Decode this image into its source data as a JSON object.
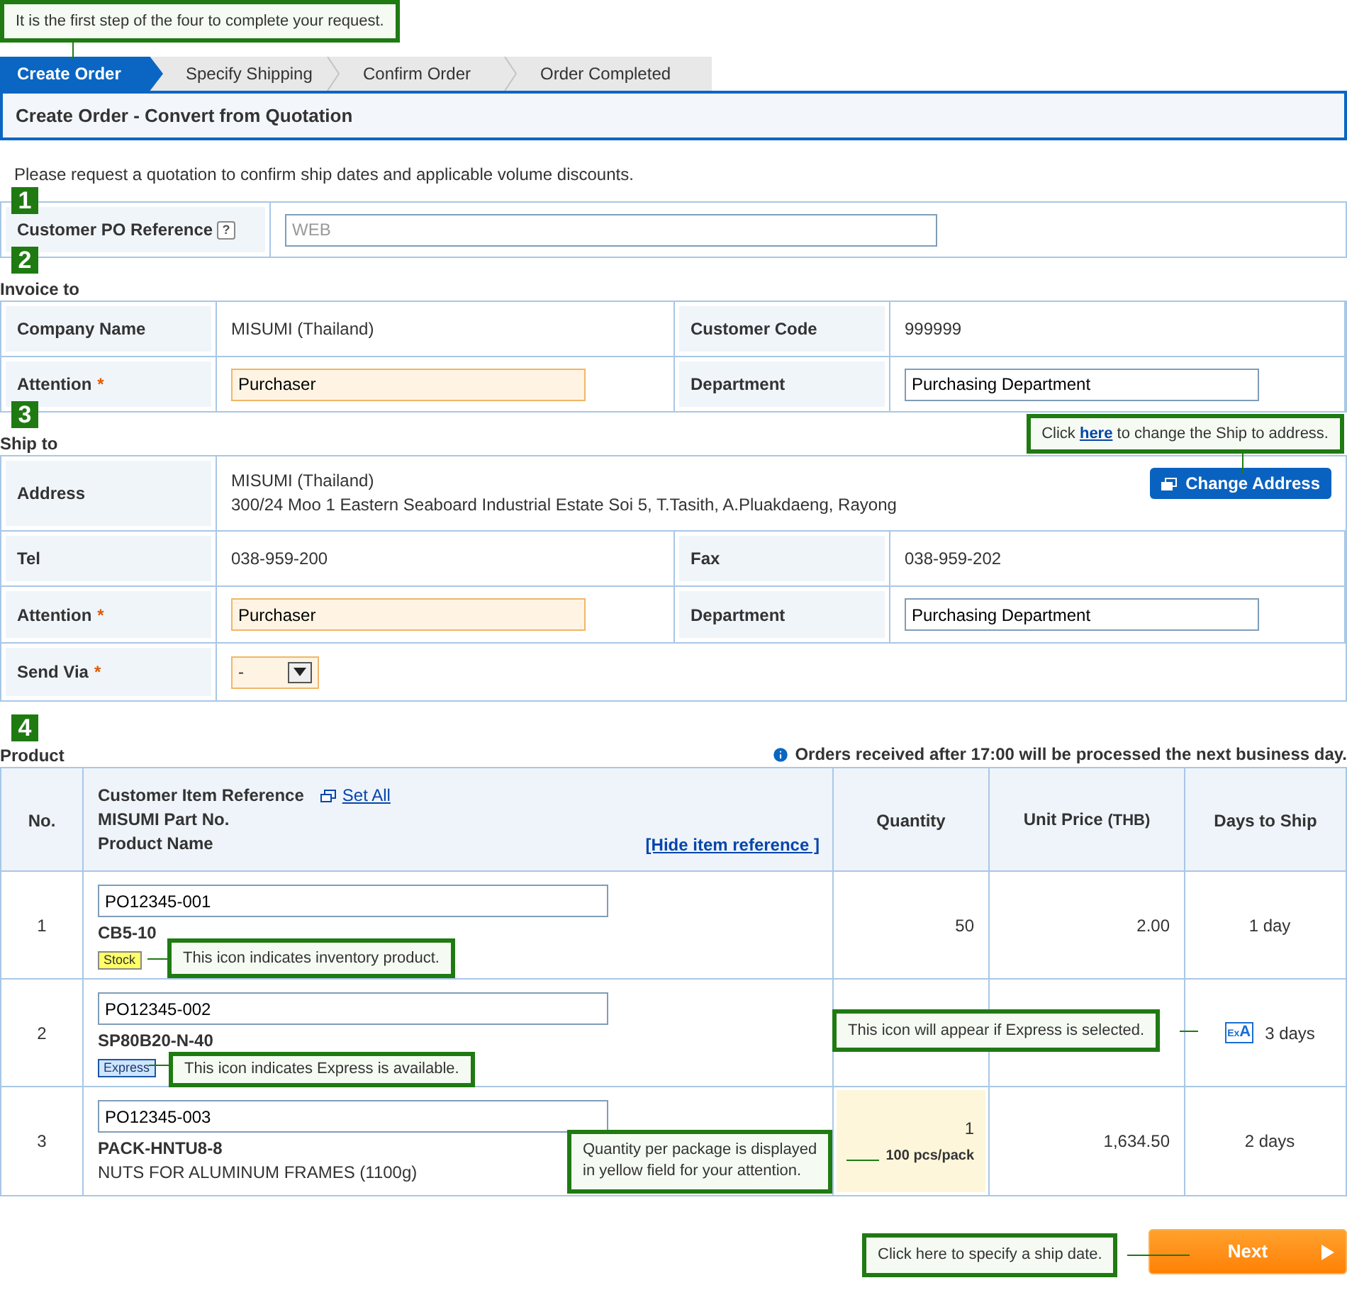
{
  "callouts": [
    {
      "text": "It is the first step of the four to complete your request."
    },
    {
      "before": "Click ",
      "link": "here",
      "after": " to change the Ship to address."
    },
    {
      "text": "This icon indicates inventory product."
    },
    {
      "text": "This icon indicates Express is available."
    },
    {
      "text": "This icon will appear if Express is selected."
    },
    {
      "lines": [
        "Quantity per package is displayed",
        "in yellow field for your attention."
      ]
    },
    {
      "text": "Click here to specify a ship date."
    }
  ],
  "steps": [
    {
      "label": "Create Order",
      "selected": true
    },
    {
      "label": "Specify Shipping",
      "selected": false
    },
    {
      "label": "Confirm Order",
      "selected": false
    },
    {
      "label": "Order Completed",
      "selected": false
    }
  ],
  "page_title": "Create Order - Convert from Quotation",
  "notice": "Please request a quotation to confirm ship dates and applicable volume discounts.",
  "required_mark": "*",
  "po": {
    "number": "1",
    "label": "Customer PO Reference",
    "help": "?",
    "placeholder": "WEB"
  },
  "invoice": {
    "number": "2",
    "title": "Invoice to",
    "rows": [
      [
        {
          "kind": "label",
          "text": "Company Name",
          "required": false
        },
        {
          "kind": "text",
          "text": "MISUMI (Thailand)"
        },
        {
          "kind": "label",
          "text": "Customer Code",
          "required": false
        },
        {
          "kind": "text",
          "text": "999999"
        }
      ],
      [
        {
          "kind": "label",
          "text": "Attention",
          "required": true
        },
        {
          "kind": "input",
          "value": "Purchaser",
          "highlight": true
        },
        {
          "kind": "label",
          "text": "Department",
          "required": false
        },
        {
          "kind": "input",
          "value": "Purchasing Department",
          "highlight": false
        }
      ]
    ]
  },
  "ship": {
    "number": "3",
    "title": "Ship to",
    "rows": [
      [
        {
          "kind": "label",
          "text": "Address",
          "required": false
        },
        {
          "kind": "address",
          "lines": [
            "MISUMI (Thailand)",
            "300/24 Moo 1 Eastern Seaboard Industrial Estate Soi 5, T.Tasith, A.Pluakdaeng, Rayong"
          ],
          "button": "Change Address"
        }
      ],
      [
        {
          "kind": "label",
          "text": "Tel",
          "required": false
        },
        {
          "kind": "text",
          "text": "038-959-200"
        },
        {
          "kind": "label",
          "text": "Fax",
          "required": false
        },
        {
          "kind": "text",
          "text": "038-959-202"
        }
      ],
      [
        {
          "kind": "label",
          "text": "Attention",
          "required": true
        },
        {
          "kind": "input",
          "value": "Purchaser",
          "highlight": true
        },
        {
          "kind": "label",
          "text": "Department",
          "required": false
        },
        {
          "kind": "input",
          "value": "Purchasing Department",
          "highlight": false
        }
      ],
      [
        {
          "kind": "label",
          "text": "Send Via",
          "required": true
        },
        {
          "kind": "select",
          "value": "-"
        }
      ]
    ]
  },
  "product": {
    "number": "4",
    "title": "Product",
    "info": "Orders received after 17:00 will be processed the next business day.",
    "columns": [
      {
        "kind": "no",
        "text": "No."
      },
      {
        "kind": "item",
        "lines": [
          "Customer Item Reference",
          "MISUMI Part No.",
          "Product Name"
        ],
        "set_all": "Set All",
        "hide": "[Hide item reference ]"
      },
      {
        "kind": "plain",
        "text": "Quantity"
      },
      {
        "kind": "price",
        "text": "Unit Price",
        "unit": "(THB)"
      },
      {
        "kind": "plain",
        "text": "Days to Ship"
      }
    ],
    "express_icon": {
      "small": "Ex",
      "big": "A"
    },
    "rows": [
      {
        "no": "1",
        "reference": "PO12345-001",
        "part_no": "CB5-10",
        "badge": {
          "kind": "stock",
          "text": "Stock"
        },
        "quantity": "50",
        "quantity_highlight": false,
        "price": "2.00",
        "days": "1 day",
        "express": false
      },
      {
        "no": "2",
        "reference": "PO12345-002",
        "part_no": "SP80B20-N-40",
        "badge": {
          "kind": "express",
          "text": "Express"
        },
        "quantity_highlight": false,
        "days": "3 days",
        "express": true
      },
      {
        "no": "3",
        "reference": "PO12345-003",
        "part_no": "PACK-HNTU8-8",
        "product_name": "NUTS FOR ALUMINUM FRAMES (1100g)",
        "quantity": "1",
        "pack": "100 pcs/pack",
        "quantity_highlight": true,
        "price": "1,634.50",
        "days": "2 days",
        "express": false
      }
    ]
  },
  "next_button": "Next"
}
